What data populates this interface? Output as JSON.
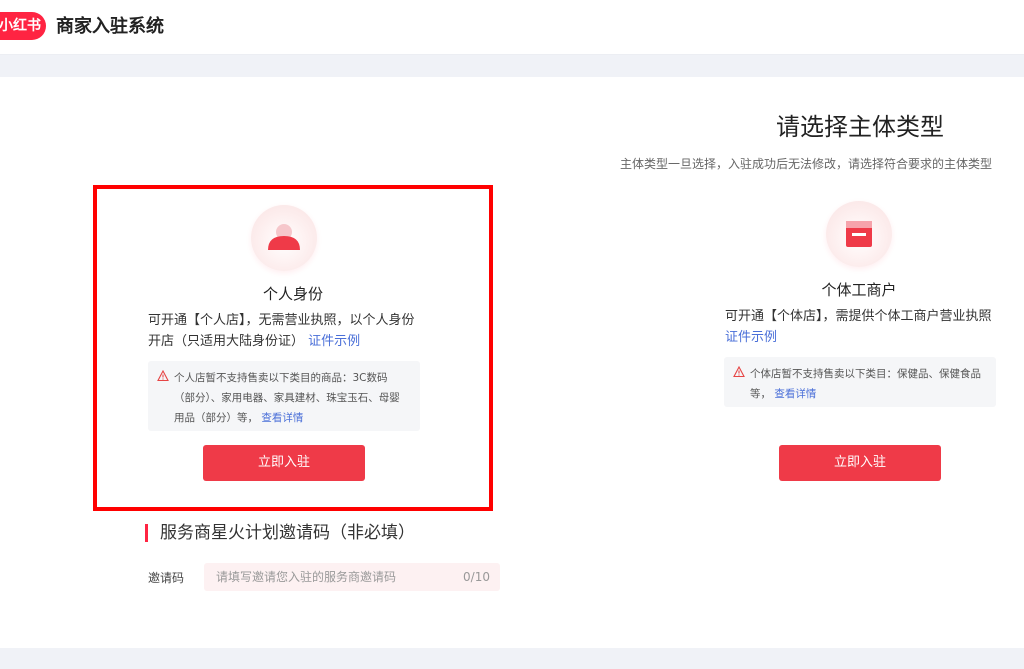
{
  "header": {
    "logo_text": "小红书",
    "app_title": "商家入驻系统"
  },
  "main": {
    "title": "请选择主体类型",
    "subtitle": "主体类型一旦选择，入驻成功后无法修改，请选择符合要求的主体类型"
  },
  "cards": [
    {
      "name": "个人身份",
      "desc_line1": "可开通【个人店】，无需营业执照，以个人身份",
      "desc_line2": "开店（只适用大陆身份证）",
      "cert_link": "证件示例",
      "notice_line1": "个人店暂不支持售卖以下类目的商品：3C数码",
      "notice_line2": "（部分）、家用电器、家具建材、珠宝玉石、母婴",
      "notice_line3": "用品（部分）等，",
      "notice_link": "查看详情",
      "button": "立即入驻"
    },
    {
      "name": "个体工商户",
      "desc_line1": "可开通【个体店】，需提供个体工商户营业执照",
      "cert_link": "证件示例",
      "notice_line1": "个体店暂不支持售卖以下类目：保健品、保健食品",
      "notice_line2": "等，",
      "notice_link": "查看详情",
      "button": "立即入驻"
    }
  ],
  "invite": {
    "title": "服务商星火计划邀请码（非必填）",
    "label": "邀请码",
    "placeholder": "请填写邀请您入驻的服务商邀请码",
    "count": "0/10"
  },
  "colors": {
    "brand": "#ff2442",
    "button": "#ef3a48",
    "link": "#4a6fd8",
    "selection_border": "#ff0000"
  }
}
